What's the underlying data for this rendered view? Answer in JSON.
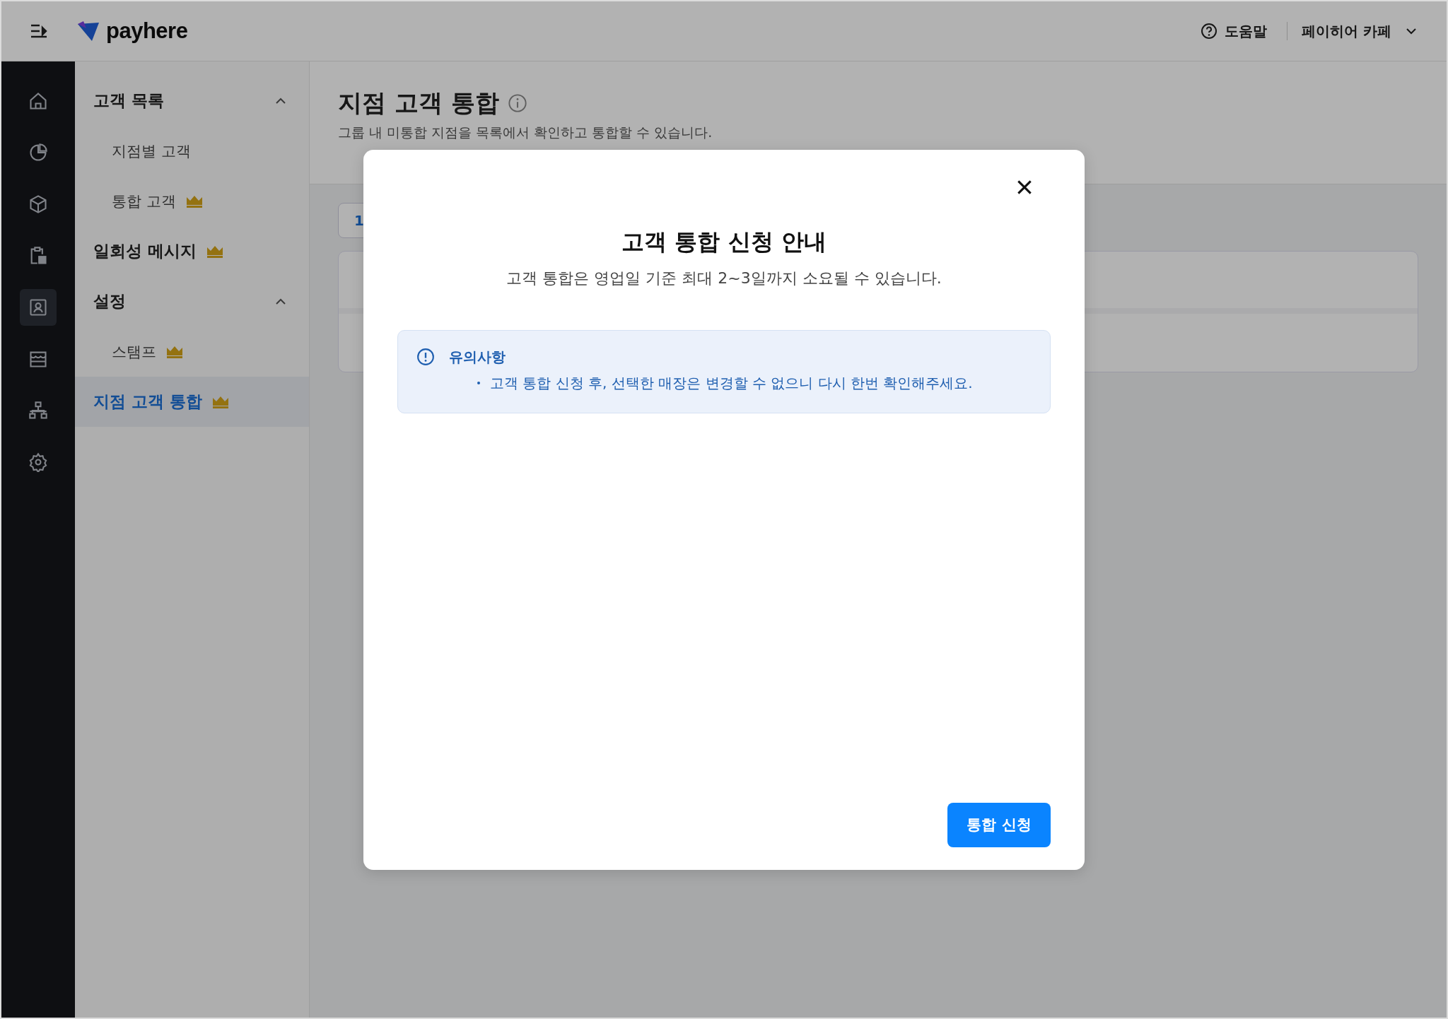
{
  "header": {
    "brand": "payhere",
    "help": "도움말",
    "store": "페이히어 카페"
  },
  "rail": [
    {
      "kind": "home",
      "selected": false
    },
    {
      "kind": "chart",
      "selected": false
    },
    {
      "kind": "box",
      "selected": false
    },
    {
      "kind": "clipboard",
      "selected": false
    },
    {
      "kind": "contact",
      "selected": true
    },
    {
      "kind": "store",
      "selected": false
    },
    {
      "kind": "org",
      "selected": false
    },
    {
      "kind": "settings",
      "selected": false
    }
  ],
  "sidebar": {
    "items": [
      {
        "label": "고객 목록",
        "kind": "group",
        "expanded": true,
        "premium": false,
        "selected": false,
        "children": [
          {
            "label": "지점별 고객",
            "premium": false,
            "selected": false
          },
          {
            "label": "통합 고객",
            "premium": true,
            "selected": false
          }
        ]
      },
      {
        "label": "일회성 메시지",
        "kind": "link",
        "premium": true,
        "selected": false
      },
      {
        "label": "설정",
        "kind": "group",
        "expanded": true,
        "premium": false,
        "selected": false,
        "children": [
          {
            "label": "스탬프",
            "premium": true,
            "selected": false
          }
        ]
      },
      {
        "label": "지점 고객 통합",
        "kind": "link",
        "premium": true,
        "selected": true
      }
    ]
  },
  "page": {
    "title": "지점 고객 통합",
    "subtitle": "그룹 내 미통합 지점을 목록에서 확인하고 통합할 수 있습니다.",
    "filter_button": "1"
  },
  "modal": {
    "title": "고객 통합 신청 안내",
    "description": "고객 통합은 영업일 기준 최대 2~3일까지 소요될 수 있습니다.",
    "notice": {
      "title": "유의사항",
      "items": [
        "고객 통합 신청 후, 선택한 매장은 변경할 수 없으니 다시 한번 확인해주세요."
      ]
    },
    "submit": "통합 신청"
  }
}
